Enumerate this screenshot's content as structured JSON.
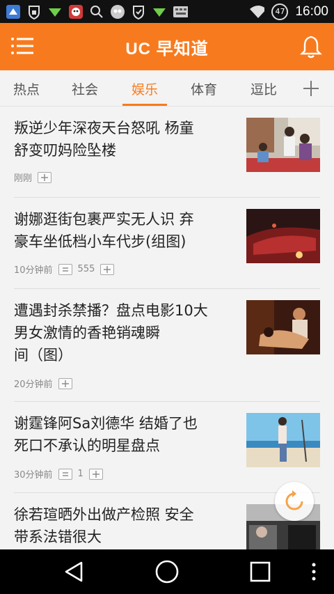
{
  "status_bar": {
    "time": "16:00",
    "battery": "47",
    "icons": [
      "app-icon",
      "lock-icon",
      "send-icon",
      "mascot-icon",
      "search-icon",
      "owl-icon",
      "shield-icon",
      "send-icon",
      "keyboard-icon"
    ]
  },
  "header": {
    "title": "UC 早知道",
    "menu_icon": "menu-icon",
    "bell_icon": "bell-icon",
    "color": "#f77b1e"
  },
  "tabs": {
    "items": [
      "热点",
      "社会",
      "娱乐",
      "体育",
      "逗比"
    ],
    "active": "娱乐",
    "add_icon": "plus-icon"
  },
  "feed": {
    "items": [
      {
        "title_line1": "叛逆少年深夜天台怒吼 杨童",
        "title_line2": "舒变叨妈险坠楼",
        "title_line3": "",
        "time": "刚刚",
        "comments": ""
      },
      {
        "title_line1": "谢娜逛街包裹严实无人识 弃",
        "title_line2": "豪车坐低档小车代步(组图)",
        "title_line3": "",
        "time": "10分钟前",
        "comments": "555"
      },
      {
        "title_line1": "遭遇封杀禁播？盘点电影10大",
        "title_line2": "男女激情的香艳销魂瞬",
        "title_line3": "间（图）",
        "time": "20分钟前",
        "comments": ""
      },
      {
        "title_line1": "谢霆锋阿Sa刘德华 结婚了也",
        "title_line2": "死口不承认的明星盘点",
        "title_line3": "",
        "time": "30分钟前",
        "comments": "1"
      },
      {
        "title_line1": "徐若瑄晒外出做产检照 安全",
        "title_line2": "带系法错很大",
        "title_line3": "",
        "time": "",
        "comments": ""
      }
    ]
  },
  "refresh_icon": "refresh-icon",
  "nav_bar": {
    "icons": [
      "back-icon",
      "home-icon",
      "recents-icon",
      "more-icon"
    ]
  }
}
